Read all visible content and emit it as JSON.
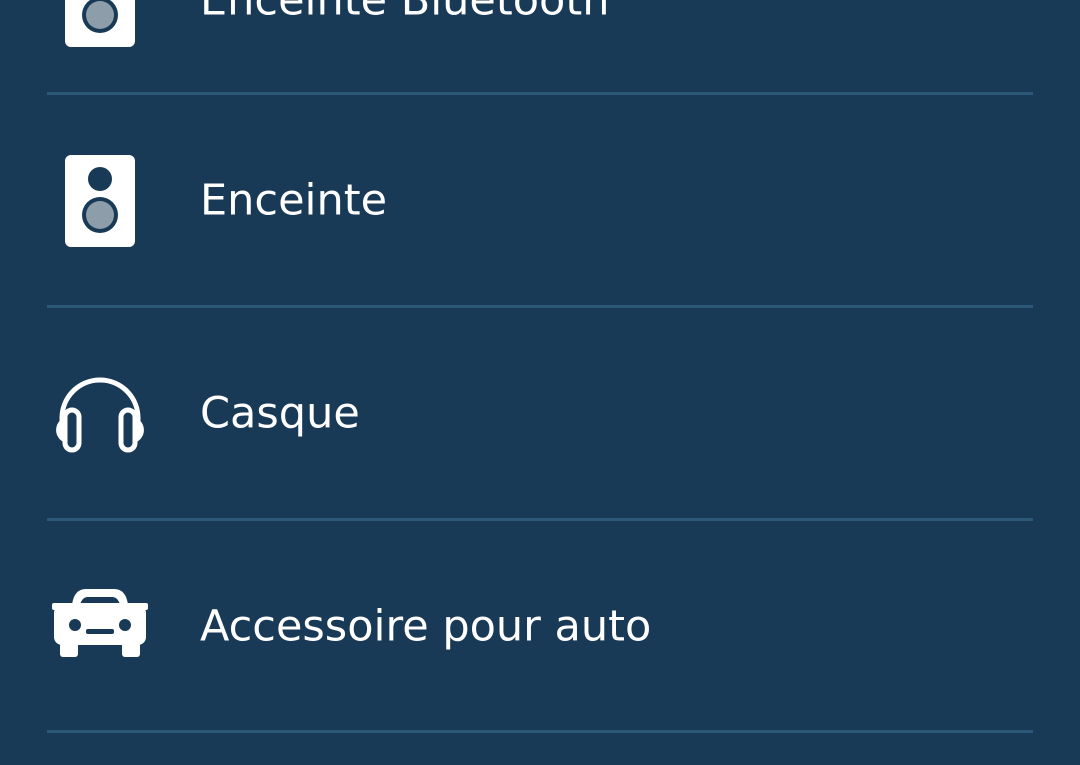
{
  "colors": {
    "background": "#193a56",
    "divider": "#2d5777",
    "text": "#ffffff",
    "icon_accent": "#8d9da9"
  },
  "device_list": {
    "items": [
      {
        "label": "Enceinte Bluetooth",
        "icon": "bluetooth-speaker-icon"
      },
      {
        "label": "Enceinte",
        "icon": "speaker-icon"
      },
      {
        "label": "Casque",
        "icon": "headphones-icon"
      },
      {
        "label": "Accessoire pour auto",
        "icon": "car-icon"
      }
    ]
  }
}
